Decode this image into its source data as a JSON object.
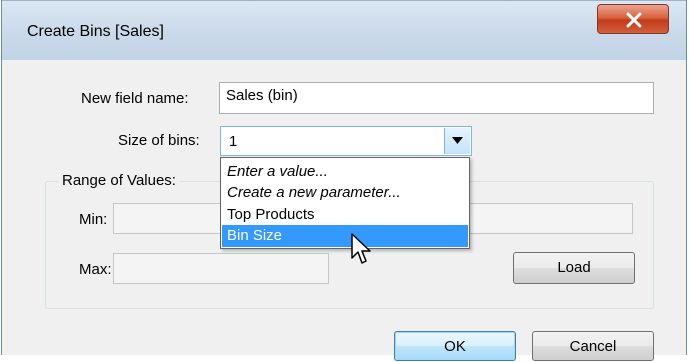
{
  "window": {
    "title": "Create Bins [Sales]"
  },
  "form": {
    "field_name_label": "New field name:",
    "field_name_value": "Sales (bin)",
    "size_label": "Size of bins:",
    "size_value": "1"
  },
  "range": {
    "group_label": "Range of Values:",
    "min_label": "Min:",
    "max_label": "Max:",
    "load_label": "Load"
  },
  "buttons": {
    "ok_label": "OK",
    "cancel_label": "Cancel"
  },
  "dropdown": {
    "items": [
      {
        "label": "Enter a value...",
        "italic": true
      },
      {
        "label": "Create a new parameter...",
        "italic": true
      },
      {
        "label": "Top Products",
        "italic": false
      },
      {
        "label": "Bin Size",
        "italic": false,
        "selected": true
      }
    ]
  },
  "colors": {
    "selection": "#3399ff",
    "close_button": "#c94a2a",
    "dialog_bg": "#f0f0f0"
  },
  "icons": {
    "close": "close-icon",
    "dropdown_arrow": "chevron-down-icon",
    "cursor": "mouse-pointer-icon"
  }
}
